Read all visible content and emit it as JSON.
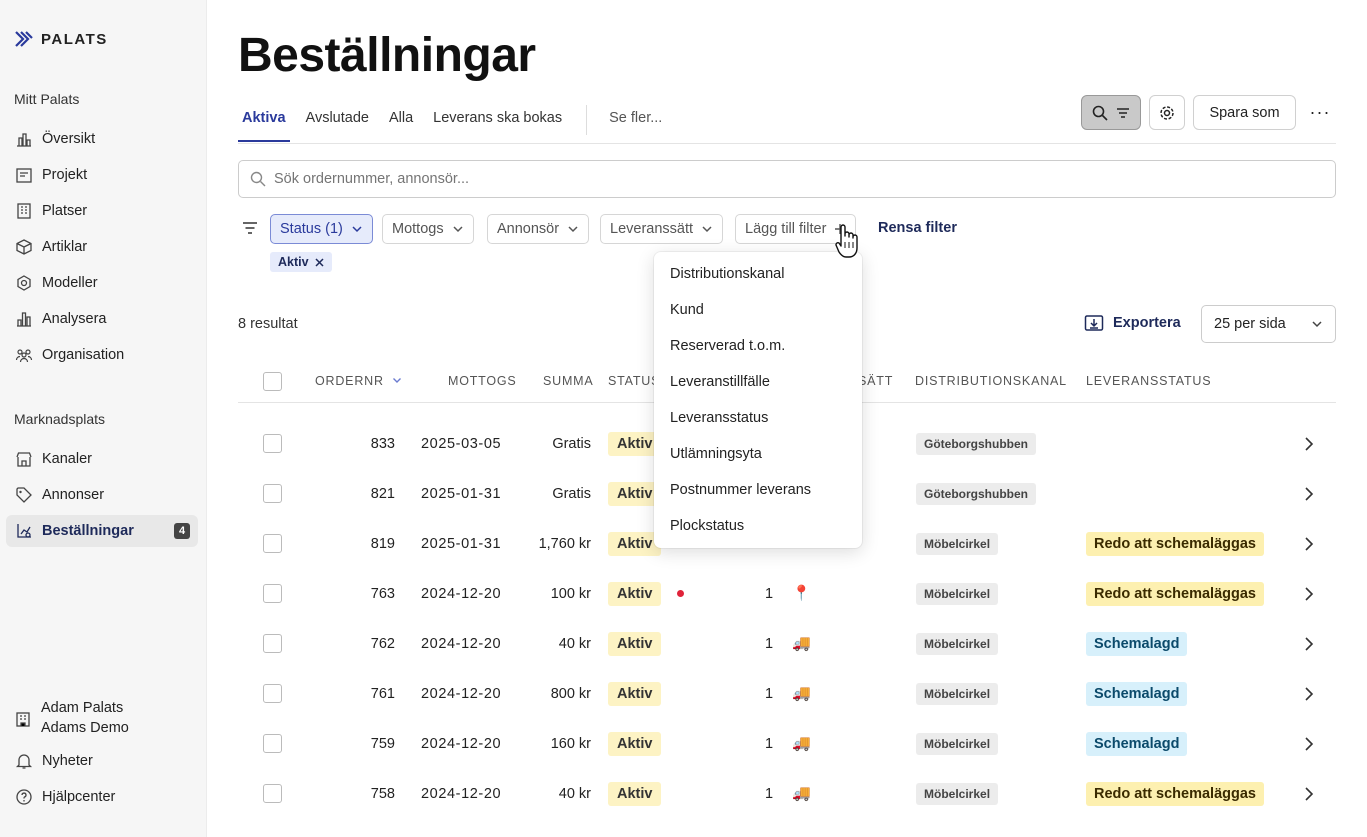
{
  "app": {
    "brand": "PALATS",
    "accent": "#2a3a9c"
  },
  "sidebar": {
    "section1": "Mitt Palats",
    "items1": [
      {
        "label": "Översikt",
        "icon": "chart-icon"
      },
      {
        "label": "Projekt",
        "icon": "project-icon"
      },
      {
        "label": "Platser",
        "icon": "building-icon"
      },
      {
        "label": "Artiklar",
        "icon": "cube-icon"
      },
      {
        "label": "Modeller",
        "icon": "hexagon-icon"
      },
      {
        "label": "Analysera",
        "icon": "bar-chart-icon"
      },
      {
        "label": "Organisation",
        "icon": "people-icon"
      }
    ],
    "section2": "Marknadsplats",
    "items2": [
      {
        "label": "Kanaler",
        "icon": "store-icon"
      },
      {
        "label": "Annonser",
        "icon": "tag-icon"
      },
      {
        "label": "Beställningar",
        "icon": "orders-icon",
        "badge": "4"
      }
    ],
    "user": {
      "name": "Adam Palats",
      "org": "Adams Demo"
    },
    "news": "Nyheter",
    "help": "Hjälpcenter"
  },
  "main": {
    "title": "Beställningar",
    "tabs": [
      "Aktiva",
      "Avslutade",
      "Alla",
      "Leverans ska bokas"
    ],
    "more_tabs": "Se fler...",
    "save_as": "Spara som",
    "more": "···",
    "search_placeholder": "Sök ordernummer, annonsör...",
    "filters": {
      "status": "Status (1)",
      "mottogs": "Mottogs",
      "annonsor": "Annonsör",
      "leveranssatt": "Leveranssätt",
      "add": "Lägg till filter",
      "clear": "Rensa filter",
      "active_tag": "Aktiv"
    },
    "results": "8 resultat",
    "export": "Exportera",
    "per_page": "25 per sida"
  },
  "table": {
    "headers": {
      "order": "ORDERNR",
      "mottogs": "MOTTOGS",
      "summa": "SUMMA",
      "status": "STATUS",
      "leveranssatt": "SÄTT",
      "kanal": "DISTRIBUTIONSKANAL",
      "levstatus": "LEVERANSSTATUS"
    },
    "rows": [
      {
        "order": "833",
        "date": "2025-03-05",
        "sum": "Gratis",
        "status": "Aktiv",
        "qty": "",
        "method": "",
        "channel": "Göteborgshubben",
        "delivery": "",
        "dtype": ""
      },
      {
        "order": "821",
        "date": "2025-01-31",
        "sum": "Gratis",
        "status": "Aktiv",
        "qty": "",
        "method": "",
        "channel": "Göteborgshubben",
        "delivery": "",
        "dtype": ""
      },
      {
        "order": "819",
        "date": "2025-01-31",
        "sum": "1,760 kr",
        "status": "Aktiv",
        "qty": "",
        "method": "",
        "channel": "Möbelcirkel",
        "delivery": "Redo att schemaläggas",
        "dtype": "redo"
      },
      {
        "order": "763",
        "date": "2024-12-20",
        "sum": "100 kr",
        "status": "Aktiv",
        "dot": true,
        "qty": "1",
        "method": "📍",
        "channel": "Möbelcirkel",
        "delivery": "Redo att schemaläggas",
        "dtype": "redo"
      },
      {
        "order": "762",
        "date": "2024-12-20",
        "sum": "40 kr",
        "status": "Aktiv",
        "qty": "1",
        "method": "🚚",
        "channel": "Möbelcirkel",
        "delivery": "Schemalagd",
        "dtype": "sched"
      },
      {
        "order": "761",
        "date": "2024-12-20",
        "sum": "800 kr",
        "status": "Aktiv",
        "qty": "1",
        "method": "🚚",
        "channel": "Möbelcirkel",
        "delivery": "Schemalagd",
        "dtype": "sched"
      },
      {
        "order": "759",
        "date": "2024-12-20",
        "sum": "160 kr",
        "status": "Aktiv",
        "qty": "1",
        "method": "🚚",
        "channel": "Möbelcirkel",
        "delivery": "Schemalagd",
        "dtype": "sched"
      },
      {
        "order": "758",
        "date": "2024-12-20",
        "sum": "40 kr",
        "status": "Aktiv",
        "qty": "1",
        "method": "🚚",
        "channel": "Möbelcirkel",
        "delivery": "Redo att schemaläggas",
        "dtype": "redo"
      }
    ]
  },
  "dropdown": {
    "items": [
      "Distributionskanal",
      "Kund",
      "Reserverad t.o.m.",
      "Leveranstillfälle",
      "Leveransstatus",
      "Utlämningsyta",
      "Postnummer leverans",
      "Plockstatus"
    ]
  }
}
